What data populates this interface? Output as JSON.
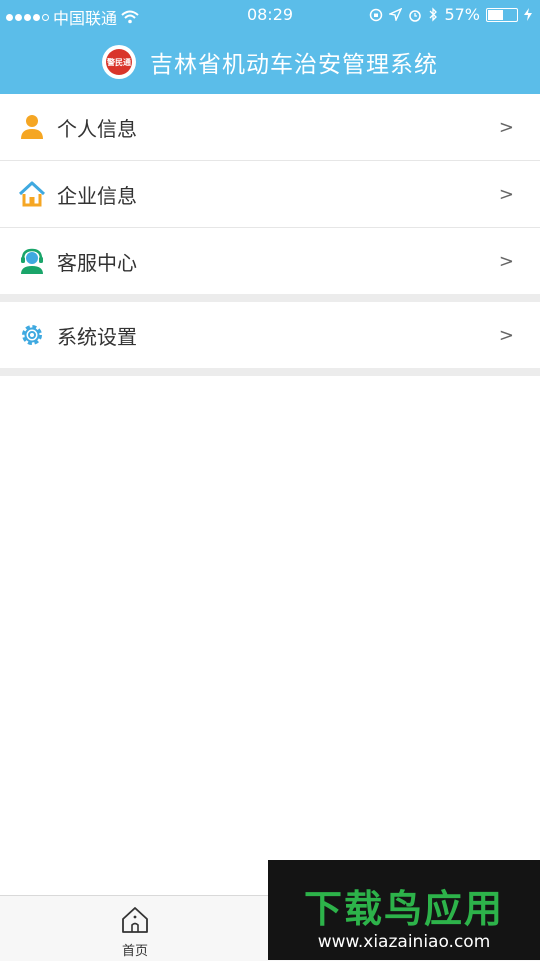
{
  "status_bar": {
    "carrier": "中国联通",
    "time": "08:29",
    "battery_percent": "57%",
    "battery_level": 0.57
  },
  "header": {
    "logo_text": "警民通",
    "title": "吉林省机动车治安管理系统",
    "bg_color": "#5bbde9"
  },
  "menu": {
    "group1": [
      {
        "label": "个人信息",
        "icon": "person-icon",
        "icon_color": "#f5a623",
        "chevron": ">"
      },
      {
        "label": "企业信息",
        "icon": "house-icon",
        "icon_color": "#3fa9e0",
        "chevron": ">"
      },
      {
        "label": "客服中心",
        "icon": "customer-service-icon",
        "icon_color": "#1aa56a",
        "chevron": ">"
      }
    ],
    "group2": [
      {
        "label": "系统设置",
        "icon": "gear-icon",
        "icon_color": "#3fa9e0",
        "chevron": ">"
      }
    ]
  },
  "tabbar": {
    "home_label": "首页"
  },
  "watermark": {
    "title": "下载鸟应用",
    "url": "www.xiazainiao.com"
  }
}
